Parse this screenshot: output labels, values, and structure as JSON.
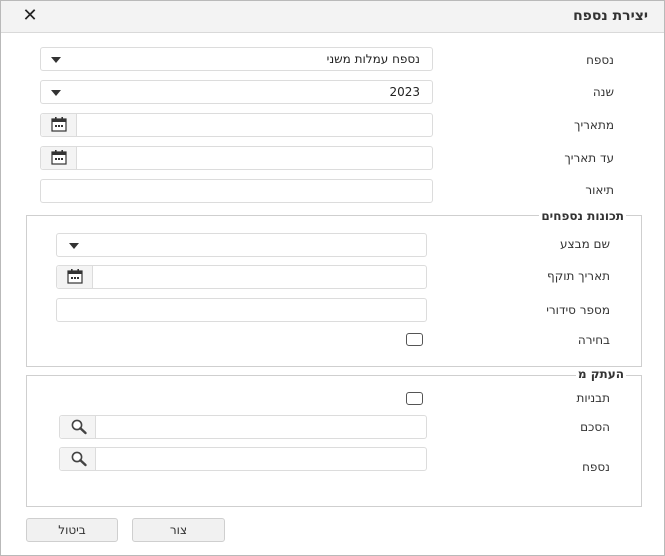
{
  "dialog": {
    "title": "יצירת נספח",
    "close_glyph": "✕"
  },
  "form": {
    "appendix_label": "נספח",
    "appendix_value": "נספח עמלות משני",
    "year_label": "שנה",
    "year_value": "2023",
    "from_date_label": "מתאריך",
    "from_date_value": "",
    "to_date_label": "עד תאריך",
    "to_date_value": "",
    "description_label": "תיאור",
    "description_value": ""
  },
  "properties": {
    "legend": "תכונות נספחים",
    "promo_name_label": "שם מבצע",
    "promo_name_value": "",
    "valid_date_label": "תאריך תוקף",
    "valid_date_value": "",
    "serial_label": "מספר סידורי",
    "serial_value": "",
    "selection_label": "בחירה",
    "selection_checked": false
  },
  "copy_from": {
    "legend": "העתק מ",
    "templates_label": "תבניות",
    "templates_checked": false,
    "agreement_label": "הסכם",
    "agreement_value": "",
    "appendix_label": "נספח",
    "appendix_value": ""
  },
  "footer": {
    "create_label": "צור",
    "cancel_label": "ביטול"
  },
  "icons": {
    "date": "calendar-icon",
    "search": "magnifier-icon",
    "dropdown": "chevron-down-icon",
    "close": "close-icon"
  }
}
